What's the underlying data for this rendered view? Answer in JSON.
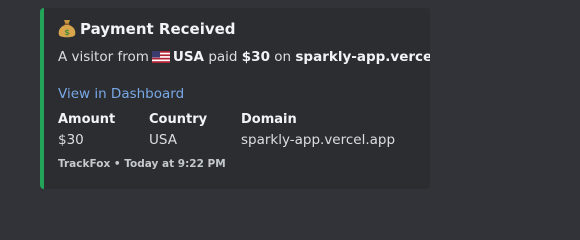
{
  "embed": {
    "accent_color": "#23a559",
    "title_icon": "money-bag-icon",
    "title": "Payment Received",
    "description": {
      "prefix": "A visitor from",
      "flag_icon": "us-flag-icon",
      "country": "USA",
      "paid_label": "paid",
      "amount": "$30",
      "on_label": "on",
      "domain": "sparkly-app.vercel.app",
      "suffix": "."
    },
    "link_label": "View in Dashboard",
    "fields": [
      {
        "name": "Amount",
        "value": "$30"
      },
      {
        "name": "Country",
        "value": "USA"
      },
      {
        "name": "Domain",
        "value": "sparkly-app.vercel.app"
      }
    ],
    "footer": {
      "source": "TrackFox",
      "separator": "•",
      "timestamp": "Today at 9:22 PM"
    }
  }
}
